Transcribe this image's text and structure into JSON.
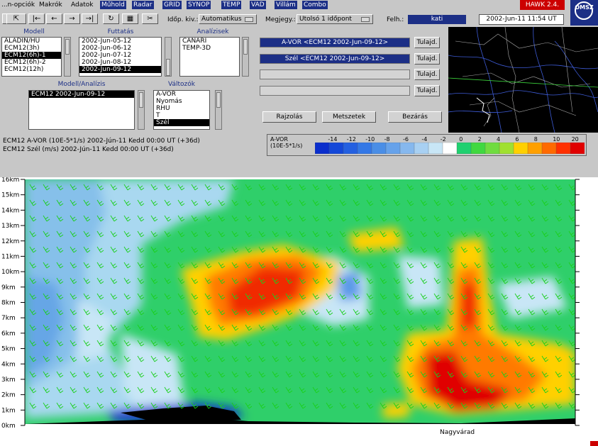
{
  "menu": {
    "items": [
      "...n-opciók",
      "Makrók",
      "Adatok",
      "Műhold",
      "Radar",
      "GRID",
      "SYNOP",
      "TEMP",
      "VAD",
      "Villám",
      "Combo"
    ],
    "active_index": 3
  },
  "app_badge": "HAWK 2.4.",
  "logo_text": "OMSZ",
  "toolbar": {
    "idop_kiv_label": "Időp. kiv.:",
    "idop_kiv_value": "Automatikus",
    "megjegy_label": "Megjegy.:",
    "megjegy_value": "Utolsó 1 időpont",
    "felh_label": "Felh.:",
    "felh_value": "kati",
    "datetime": "2002-Jun-11  11:54 UT"
  },
  "modell": {
    "title": "Modell",
    "items": [
      "ALADIN/HU",
      "ECM12(3h)",
      "ECM12(6h)-1",
      "ECM12(6h)-2",
      "ECM12(12h)"
    ],
    "selected": 2
  },
  "futtatas": {
    "title": "Futtatás",
    "items": [
      "2002-Jun-05-12",
      "2002-Jun-06-12",
      "2002-Jun-07-12",
      "2002-Jun-08-12",
      "2002-Jun-09-12"
    ],
    "selected": 4
  },
  "analizisek": {
    "title": "Analízisek",
    "items": [
      "CANARI",
      "TEMP-3D"
    ]
  },
  "modell_analizis": {
    "title": "Modell/Analízis",
    "items": [
      "ECM12 2002-Jun-09-12"
    ],
    "selected": 0
  },
  "valtozok": {
    "title": "Változók",
    "items": [
      "A-VOR",
      "Nyomás",
      "RHU",
      "T",
      "Szél"
    ],
    "selected": 4
  },
  "variable_fields": [
    {
      "text": "A-VOR <ECM12 2002-Jun-09-12>",
      "button": "Tulajd.",
      "filled": true
    },
    {
      "text": "Szél <ECM12 2002-Jun-09-12>",
      "button": "Tulajd.",
      "filled": true
    },
    {
      "text": "",
      "button": "Tulajd.",
      "filled": false
    },
    {
      "text": "",
      "button": "Tulajd.",
      "filled": false
    }
  ],
  "actions": {
    "rajzolas": "Rajzolás",
    "metszetek": "Metszetek",
    "bezaras": "Bezárás"
  },
  "plot_info": {
    "line1": "ECM12  A-VOR (10E-5*1/s)  2002-Jún-11 Kedd 00:00 UT (+36d)",
    "line2": "ECM12  Szél (m/s)  2002-Jún-11 Kedd 00:00 UT (+36d)"
  },
  "colorbar": {
    "title1": "A-VOR",
    "title2": "(10E-5*1/s)",
    "ticks": [
      "-14",
      "-12",
      "-10",
      "-8",
      "-6",
      "-4",
      "-2",
      "0",
      "2",
      "4",
      "6",
      "8",
      "10",
      "20"
    ],
    "colors": [
      "#0a2ecc",
      "#1448d8",
      "#2460e0",
      "#3478e6",
      "#4a8ee6",
      "#66a2ea",
      "#86b8ee",
      "#a8d0f2",
      "#c8e6f6",
      "#ffffff",
      "#20d070",
      "#40d840",
      "#70dc40",
      "#a0e030",
      "#ffd000",
      "#ffa000",
      "#ff6a00",
      "#ff3000",
      "#e00000"
    ]
  },
  "chart_data": {
    "type": "heatmap",
    "title": "",
    "ylabel": "",
    "y_ticks": [
      "16km",
      "15km",
      "14km",
      "13km",
      "12km",
      "11km",
      "10km",
      "9km",
      "8km",
      "7km",
      "6km",
      "5km",
      "4km",
      "3km",
      "2km",
      "1km",
      "0km"
    ],
    "ylim": [
      0,
      16
    ],
    "xlabel_annotation": "Nagyvárad"
  }
}
